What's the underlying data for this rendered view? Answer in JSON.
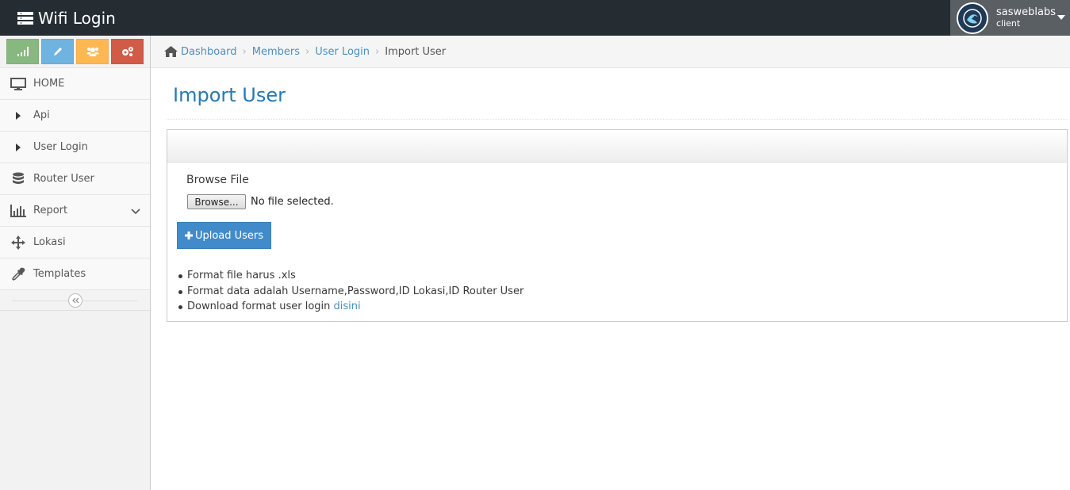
{
  "app": {
    "title": "Wifi Login"
  },
  "user": {
    "name": "sasweblabs",
    "role": "client"
  },
  "colors": {
    "navbar": "#252d33",
    "link": "#4c8fbd",
    "title": "#2679b5",
    "primary_button": "#428bca",
    "shortcut_green": "#87b87f",
    "shortcut_blue": "#6fb3e0",
    "shortcut_yellow": "#ffb752",
    "shortcut_red": "#d15b47"
  },
  "shortcuts": [
    {
      "icon": "signal-icon"
    },
    {
      "icon": "pencil-icon"
    },
    {
      "icon": "group-icon"
    },
    {
      "icon": "cogs-icon"
    }
  ],
  "sidebar": {
    "items": [
      {
        "label": "HOME",
        "icon": "desktop-icon"
      },
      {
        "label": "Api",
        "icon": "caret-right-icon"
      },
      {
        "label": "User Login",
        "icon": "caret-right-icon"
      },
      {
        "label": "Router User",
        "icon": "database-icon"
      },
      {
        "label": "Report",
        "icon": "bar-chart-icon"
      },
      {
        "label": "Lokasi",
        "icon": "move-icon"
      },
      {
        "label": "Templates",
        "icon": "eyedropper-icon"
      }
    ]
  },
  "breadcrumb": {
    "items": [
      "Dashboard",
      "Members",
      "User Login"
    ],
    "active": "Import User"
  },
  "page": {
    "title": "Import User",
    "form": {
      "label": "Browse File",
      "browse_button": "Browse...",
      "file_status": "No file selected.",
      "upload_button": "Upload Users"
    },
    "notes": [
      "Format file harus .xls",
      "Format data adalah Username,Password,ID Lokasi,ID Router User"
    ],
    "download_note": {
      "text": "Download format user login ",
      "link": "disini"
    }
  }
}
